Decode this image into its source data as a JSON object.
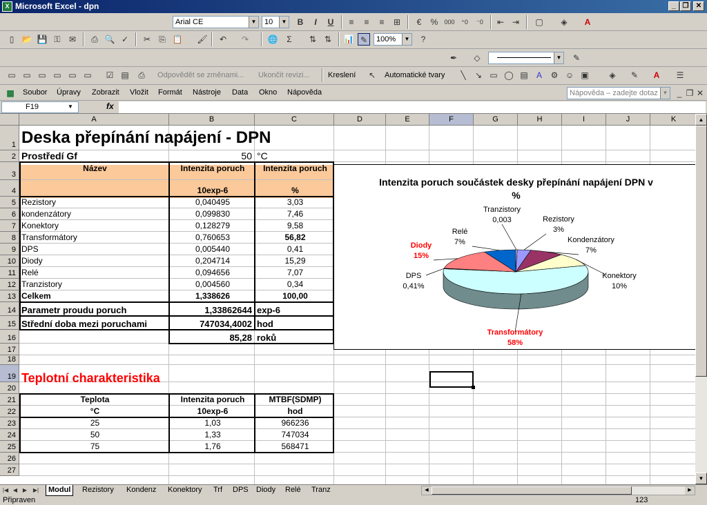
{
  "window": {
    "title": "Microsoft Excel - dpn",
    "app_icon": "X"
  },
  "toolbar": {
    "font_name": "Arial CE",
    "font_size": "10",
    "zoom": "100%",
    "draw_label": "Kreslení",
    "autoshapes": "Automatické tvary",
    "reply": "Odpovědět se změnami...",
    "end_review": "Ukončit revizi...",
    "help_placeholder": "Nápověda – zadejte dotaz"
  },
  "menu": [
    "Soubor",
    "Úpravy",
    "Zobrazit",
    "Vložit",
    "Formát",
    "Nástroje",
    "Data",
    "Okno",
    "Nápověda"
  ],
  "namebox": "F19",
  "fx": "fx",
  "columns": [
    "A",
    "B",
    "C",
    "D",
    "E",
    "F",
    "G",
    "H",
    "I",
    "J",
    "K"
  ],
  "rows": [
    "1",
    "2",
    "3",
    "4",
    "5",
    "6",
    "7",
    "8",
    "9",
    "10",
    "11",
    "12",
    "13",
    "14",
    "15",
    "16",
    "17",
    "18",
    "19",
    "20",
    "21",
    "22",
    "23",
    "24",
    "25",
    "26",
    "27"
  ],
  "sheet": {
    "title": "Deska přepínání napájení - DPN",
    "env_label": "Prostředí Gf",
    "env_value": "50",
    "env_unit": "°C",
    "hdr_name": "Název",
    "hdr_rate": "Intenzita poruch",
    "hdr_pct": "Intenzita poruch",
    "unit_rate": "10exp-6",
    "unit_pct": "%",
    "items": [
      {
        "name": "Rezistory",
        "rate": "0,040495",
        "pct": "3,03"
      },
      {
        "name": "kondenzátory",
        "rate": "0,099830",
        "pct": "7,46"
      },
      {
        "name": "Konektory",
        "rate": "0,128279",
        "pct": "9,58"
      },
      {
        "name": "Transformátory",
        "rate": "0,760653",
        "pct": "56,82"
      },
      {
        "name": "DPS",
        "rate": "0,005440",
        "pct": "0,41"
      },
      {
        "name": "Diody",
        "rate": "0,204714",
        "pct": "15,29"
      },
      {
        "name": "Relé",
        "rate": "0,094656",
        "pct": "7,07"
      },
      {
        "name": "Tranzistory",
        "rate": "0,004560",
        "pct": "0,34"
      }
    ],
    "total_label": "Celkem",
    "total_rate": "1,338626",
    "total_pct": "100,00",
    "param_label": "Parametr proudu poruch",
    "param_value": "1,33862644",
    "param_unit": "exp-6",
    "mtbf_label": "Střední doba mezi poruchami",
    "mtbf_value": "747034,4002",
    "mtbf_unit": "hod",
    "years_value": "85,28",
    "years_unit": "roků",
    "temp_title": "Teplotní charakteristika",
    "temp_hdr": [
      "Teplota",
      "Intenzita poruch",
      "MTBF(SDMP)"
    ],
    "temp_units": [
      "°C",
      "10exp-6",
      "hod"
    ],
    "temp_rows": [
      [
        "25",
        "1,03",
        "966236"
      ],
      [
        "50",
        "1,33",
        "747034"
      ],
      [
        "75",
        "1,76",
        "568471"
      ]
    ]
  },
  "chart_data": {
    "type": "pie",
    "title": "Intenzita poruch součástek desky přepínání napájení DPN v %",
    "slices": [
      {
        "name": "Rezistory",
        "value": 3.03,
        "label": "3%",
        "color": "#9999ff"
      },
      {
        "name": "Kondenzátory",
        "value": 7.46,
        "label": "7%",
        "color": "#993366"
      },
      {
        "name": "Konektory",
        "value": 9.58,
        "label": "10%",
        "color": "#ffffcc"
      },
      {
        "name": "Transformátory",
        "value": 56.82,
        "label": "58%",
        "color": "#ccffff"
      },
      {
        "name": "DPS",
        "value": 0.41,
        "label": "0,41%",
        "color": "#660066"
      },
      {
        "name": "Diody",
        "value": 15.29,
        "label": "15%",
        "color": "#ff8080"
      },
      {
        "name": "Relé",
        "value": 7.07,
        "label": "7%",
        "color": "#0066cc"
      },
      {
        "name": "Tranzistory",
        "value": 0.34,
        "label": "0,003",
        "color": "#ccccff"
      }
    ],
    "highlight_color": "#ff0000"
  },
  "tabs": [
    "Modul",
    "Rezistory",
    "Kondenz",
    "Konektory",
    "Trf",
    "DPS",
    "Diody",
    "Relé",
    "Tranz"
  ],
  "status": {
    "left": "Připraven",
    "right": "123"
  }
}
